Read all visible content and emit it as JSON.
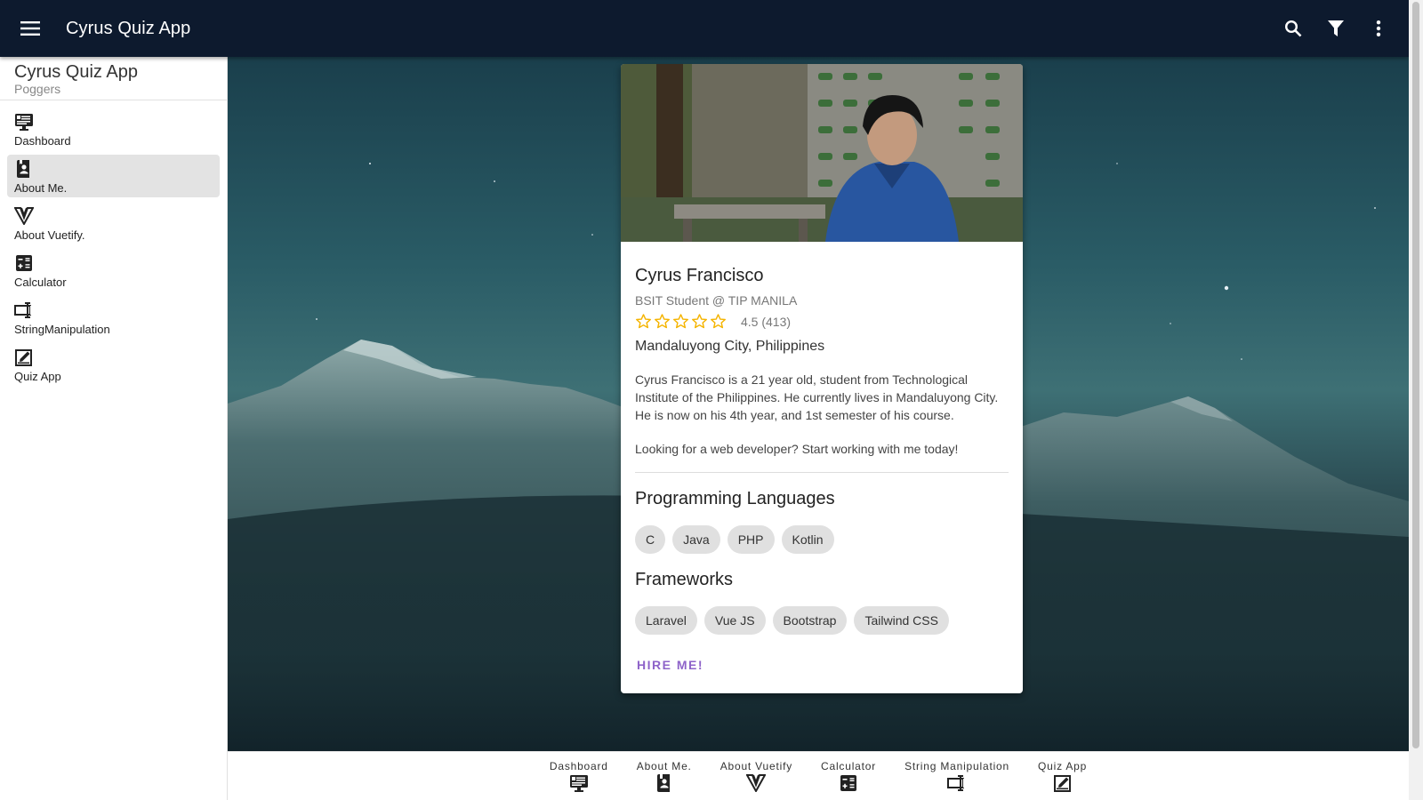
{
  "appbar": {
    "title": "Cyrus Quiz App",
    "icons": [
      "menu-icon",
      "search-icon",
      "filter-icon",
      "more-vertical-icon"
    ]
  },
  "drawer": {
    "title": "Cyrus Quiz App",
    "subtitle": "Poggers",
    "items": [
      {
        "label": "Dashboard",
        "icon": "monitor-dashboard-icon"
      },
      {
        "label": "About Me.",
        "icon": "book-account-icon",
        "active": true
      },
      {
        "label": "About Vuetify.",
        "icon": "vuetify-icon"
      },
      {
        "label": "Calculator",
        "icon": "calculator-icon"
      },
      {
        "label": "StringManipulation",
        "icon": "form-textbox-icon"
      },
      {
        "label": "Quiz App",
        "icon": "pencil-box-icon"
      }
    ]
  },
  "card": {
    "name": "Cyrus Francisco",
    "subtitle": "BSIT Student @ TIP MANILA",
    "rating_value": 4.5,
    "rating_text": "4.5 (413)",
    "location": "Mandaluyong City, Philippines",
    "bio": "Cyrus Francisco is a 21 year old, student from Technological Institute of the Philippines. He currently lives in Mandaluyong City. He is now on his 4th year, and 1st semester of his course.",
    "cta_text": "Looking for a web developer? Start working with me today!",
    "languages_title": "Programming Languages",
    "languages": [
      "C",
      "Java",
      "PHP",
      "Kotlin"
    ],
    "frameworks_title": "Frameworks",
    "frameworks": [
      "Laravel",
      "Vue JS",
      "Bootstrap",
      "Tailwind CSS"
    ],
    "hire_label": "HIRE ME!"
  },
  "bottomnav": {
    "items": [
      {
        "label": "Dashboard",
        "icon": "monitor-dashboard-icon"
      },
      {
        "label": "About Me.",
        "icon": "book-account-icon"
      },
      {
        "label": "About Vuetify",
        "icon": "vuetify-icon"
      },
      {
        "label": "Calculator",
        "icon": "calculator-icon"
      },
      {
        "label": "String Manipulation",
        "icon": "form-textbox-icon"
      },
      {
        "label": "Quiz App",
        "icon": "pencil-box-icon"
      }
    ]
  },
  "colors": {
    "appbar": "#0d1a2e",
    "accent": "#8e63c9",
    "star": "#f5b400"
  }
}
